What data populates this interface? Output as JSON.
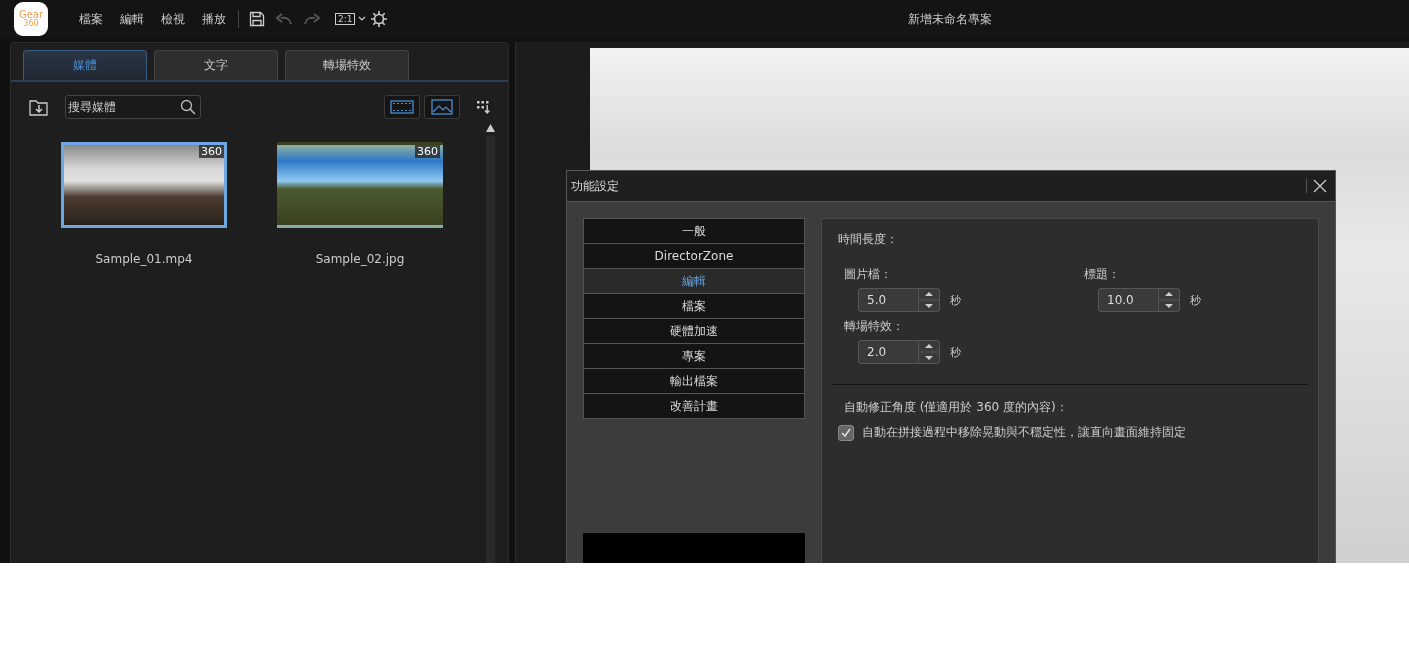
{
  "app": {
    "logo": [
      "Gear",
      "360"
    ],
    "menu": [
      "檔案",
      "編輯",
      "檢視",
      "播放"
    ],
    "zoom_label": "2:1",
    "title": "新增未命名專案"
  },
  "media_panel": {
    "tabs": [
      {
        "label": "媒體",
        "selected": true
      },
      {
        "label": "文字",
        "selected": false
      },
      {
        "label": "轉場特效",
        "selected": false
      }
    ],
    "search": {
      "placeholder": "搜尋媒體"
    },
    "items": [
      {
        "name": "Sample_01.mp4",
        "badge": "360",
        "kind": "indoor",
        "selected": true
      },
      {
        "name": "Sample_02.jpg",
        "badge": "360",
        "kind": "landscape",
        "selected": false
      }
    ]
  },
  "dialog": {
    "title": "功能設定",
    "categories": [
      {
        "label": "一般",
        "selected": false
      },
      {
        "label": "DirectorZone",
        "selected": false
      },
      {
        "label": "編輯",
        "selected": true
      },
      {
        "label": "檔案",
        "selected": false
      },
      {
        "label": "硬體加速",
        "selected": false
      },
      {
        "label": "專案",
        "selected": false
      },
      {
        "label": "輸出檔案",
        "selected": false
      },
      {
        "label": "改善計畫",
        "selected": false
      }
    ],
    "section_title": "時間長度：",
    "fields": [
      {
        "label": "圖片檔：",
        "value": "5.0",
        "unit": "秒"
      },
      {
        "label": "標題：",
        "value": "10.0",
        "unit": "秒"
      },
      {
        "label": "轉場特效：",
        "value": "2.0",
        "unit": "秒"
      }
    ],
    "auto_title": "自動修正角度 (僅適用於 360 度的內容)：",
    "option": {
      "label": "自動在拼接過程中移除晃動與不穩定性，讓直向畫面維持固定",
      "checked": true
    }
  }
}
